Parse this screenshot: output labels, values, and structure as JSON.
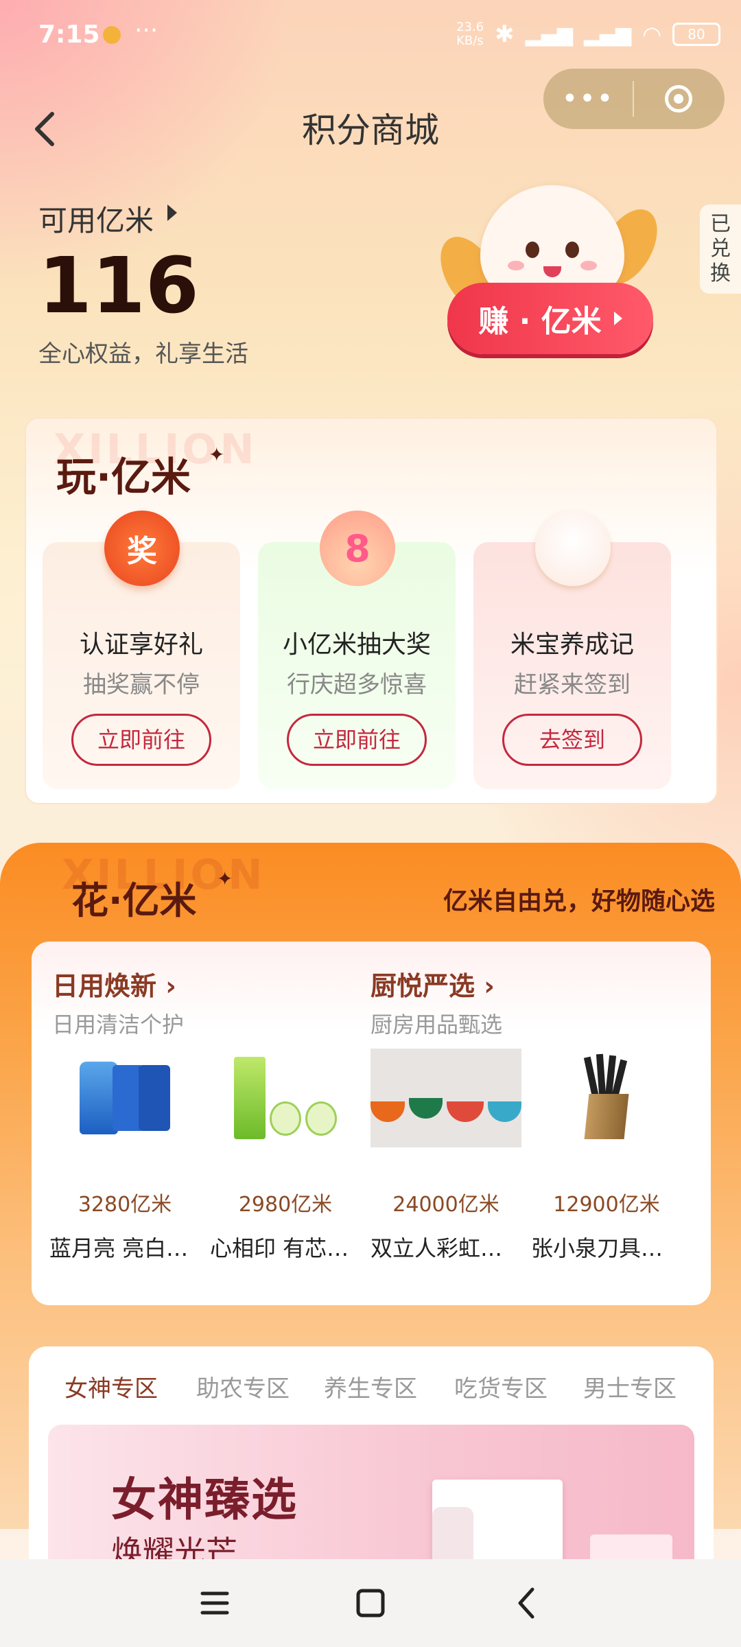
{
  "status_bar": {
    "time": "7:15",
    "more": "···",
    "network_speed": "23.6\nKB/s",
    "battery": "80"
  },
  "header": {
    "title": "积分商城",
    "capsule_more": "•••"
  },
  "points": {
    "label": "可用亿米",
    "value": "116",
    "subtitle": "全心权益，礼享生活"
  },
  "earn": {
    "label": "赚 · 亿米"
  },
  "redeemed_tab": [
    "已",
    "兑",
    "换"
  ],
  "play": {
    "watermark": "XILLION",
    "title": "玩·亿米",
    "tasks": [
      {
        "name": "认证享好礼",
        "subtitle": "抽奖赢不停",
        "button": "立即前往",
        "badge": "奖",
        "bg": "#fdeee2"
      },
      {
        "name": "小亿米抽大奖",
        "subtitle": "行庆超多惊喜",
        "button": "立即前往",
        "badge": "8",
        "bg": "#edfce6"
      },
      {
        "name": "米宝养成记",
        "subtitle": "赶紧来签到",
        "button": "去签到",
        "badge": "",
        "bg": "#fde6e4"
      }
    ]
  },
  "spend": {
    "watermark": "XILLION",
    "title": "花·亿米",
    "slogan": "亿米自由兑，好物随心选",
    "categories": [
      {
        "title": "日用焕新",
        "subtitle": "日用清洁个护"
      },
      {
        "title": "厨悦严选",
        "subtitle": "厨房用品甄选"
      }
    ],
    "goods": [
      {
        "price": "3280亿米",
        "name": "蓝月亮 亮白…"
      },
      {
        "price": "2980亿米",
        "name": "心相印 有芯…"
      },
      {
        "price": "24000亿米",
        "name": "双立人彩虹…"
      },
      {
        "price": "12900亿米",
        "name": "张小泉刀具…"
      }
    ]
  },
  "zones": {
    "tabs": [
      "女神专区",
      "助农专区",
      "养生专区",
      "吃货专区",
      "男士专区"
    ],
    "active_index": 0,
    "banner_title": "女神臻选",
    "banner_sub": "焕耀光芒"
  },
  "colors": {
    "accent_red": "#c4283e",
    "title_brown": "#5a1a10",
    "orange": "#fb8c23"
  }
}
